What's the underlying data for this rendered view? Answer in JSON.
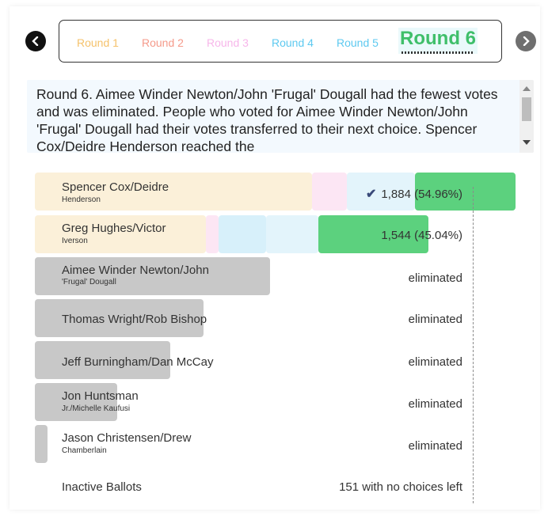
{
  "rounds": [
    {
      "label": "Round 1",
      "color": "#f5c26b"
    },
    {
      "label": "Round 2",
      "color": "#f59a8a"
    },
    {
      "label": "Round 3",
      "color": "#f7b6ea"
    },
    {
      "label": "Round 4",
      "color": "#5dc9f0"
    },
    {
      "label": "Round 5",
      "color": "#5dc9f0"
    },
    {
      "label": "Round 6",
      "color": "#3fbf6a"
    }
  ],
  "narrative": "Round 6. Aimee Winder Newton/John 'Frugal' Dougall had the fewest votes and was eliminated. People who voted for Aimee Winder Newton/John 'Frugal' Dougall had their votes transferred to their next choice. Spencer Cox/Deidre Henderson reached the",
  "candidates": [
    {
      "name": "Spencer Cox/Deidre",
      "sub": "Henderson",
      "result": "1,884 (54.96%)",
      "winner": true,
      "status": "active",
      "vote_share": 0.5496
    },
    {
      "name": "Greg Hughes/Victor",
      "sub": "Iverson",
      "result": "1,544 (45.04%)",
      "winner": false,
      "status": "active",
      "vote_share": 0.4504
    },
    {
      "name": "Aimee Winder Newton/John",
      "sub": "'Frugal' Dougall",
      "result": "eliminated",
      "winner": false,
      "status": "eliminated"
    },
    {
      "name": "Thomas Wright/Rob Bishop",
      "sub": "",
      "result": "eliminated",
      "winner": false,
      "status": "eliminated"
    },
    {
      "name": "Jeff Burningham/Dan McCay",
      "sub": "",
      "result": "eliminated",
      "winner": false,
      "status": "eliminated"
    },
    {
      "name": "Jon Huntsman",
      "sub": "Jr./Michelle Kaufusi",
      "result": "eliminated",
      "winner": false,
      "status": "eliminated"
    },
    {
      "name": "Jason Christensen/Drew",
      "sub": "Chamberlain",
      "result": "eliminated",
      "winner": false,
      "status": "eliminated"
    }
  ],
  "inactive": {
    "label": "Inactive Ballots",
    "result": "151 with no choices left"
  },
  "colors": {
    "round1": "#fbf0d9",
    "round2": "#fce6f4",
    "round3": "#e3f4fb",
    "round4": "#d7f0fa",
    "winner": "#5cd17e",
    "eliminated": "#c8c8c8"
  }
}
